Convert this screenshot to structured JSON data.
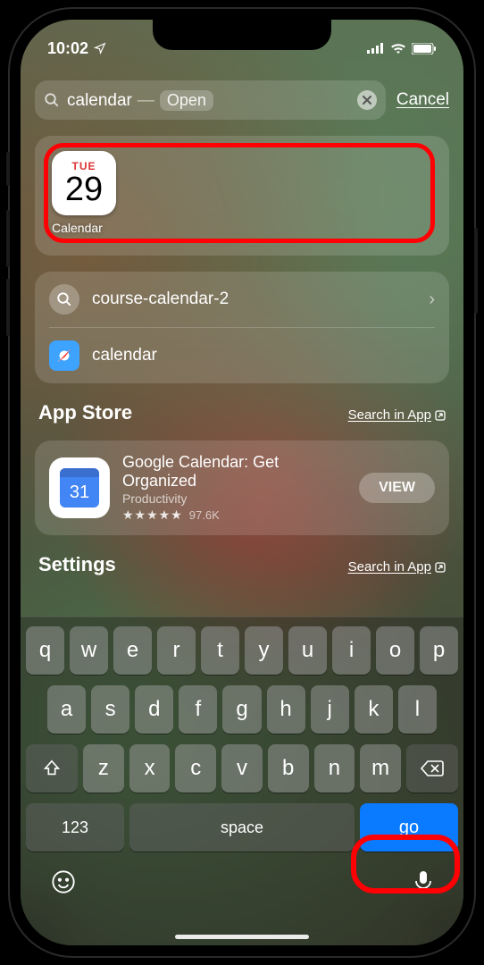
{
  "status": {
    "time": "10:02"
  },
  "search": {
    "query": "calendar",
    "hint_dash": "—",
    "hint_action": "Open",
    "cancel_label": "Cancel"
  },
  "app_result": {
    "day_name": "TUE",
    "day_num": "29",
    "label": "Calendar"
  },
  "suggestions": [
    {
      "label": "course-calendar-2",
      "type": "search"
    },
    {
      "label": "calendar",
      "type": "safari"
    }
  ],
  "app_store": {
    "header": "App Store",
    "search_in_app": "Search in App",
    "icon_num": "31",
    "title": "Google Calendar: Get Organized",
    "subtitle": "Productivity",
    "stars": "★★★★½",
    "rating_text": "★★★★",
    "rating_half": "⯪",
    "rating_count": "97.6K",
    "view_label": "VIEW"
  },
  "settings": {
    "header": "Settings",
    "search_in_app": "Search in App"
  },
  "keyboard": {
    "row1": [
      "q",
      "w",
      "e",
      "r",
      "t",
      "y",
      "u",
      "i",
      "o",
      "p"
    ],
    "row2": [
      "a",
      "s",
      "d",
      "f",
      "g",
      "h",
      "j",
      "k",
      "l"
    ],
    "row3": [
      "z",
      "x",
      "c",
      "v",
      "b",
      "n",
      "m"
    ],
    "num_label": "123",
    "space_label": "space",
    "go_label": "go"
  }
}
